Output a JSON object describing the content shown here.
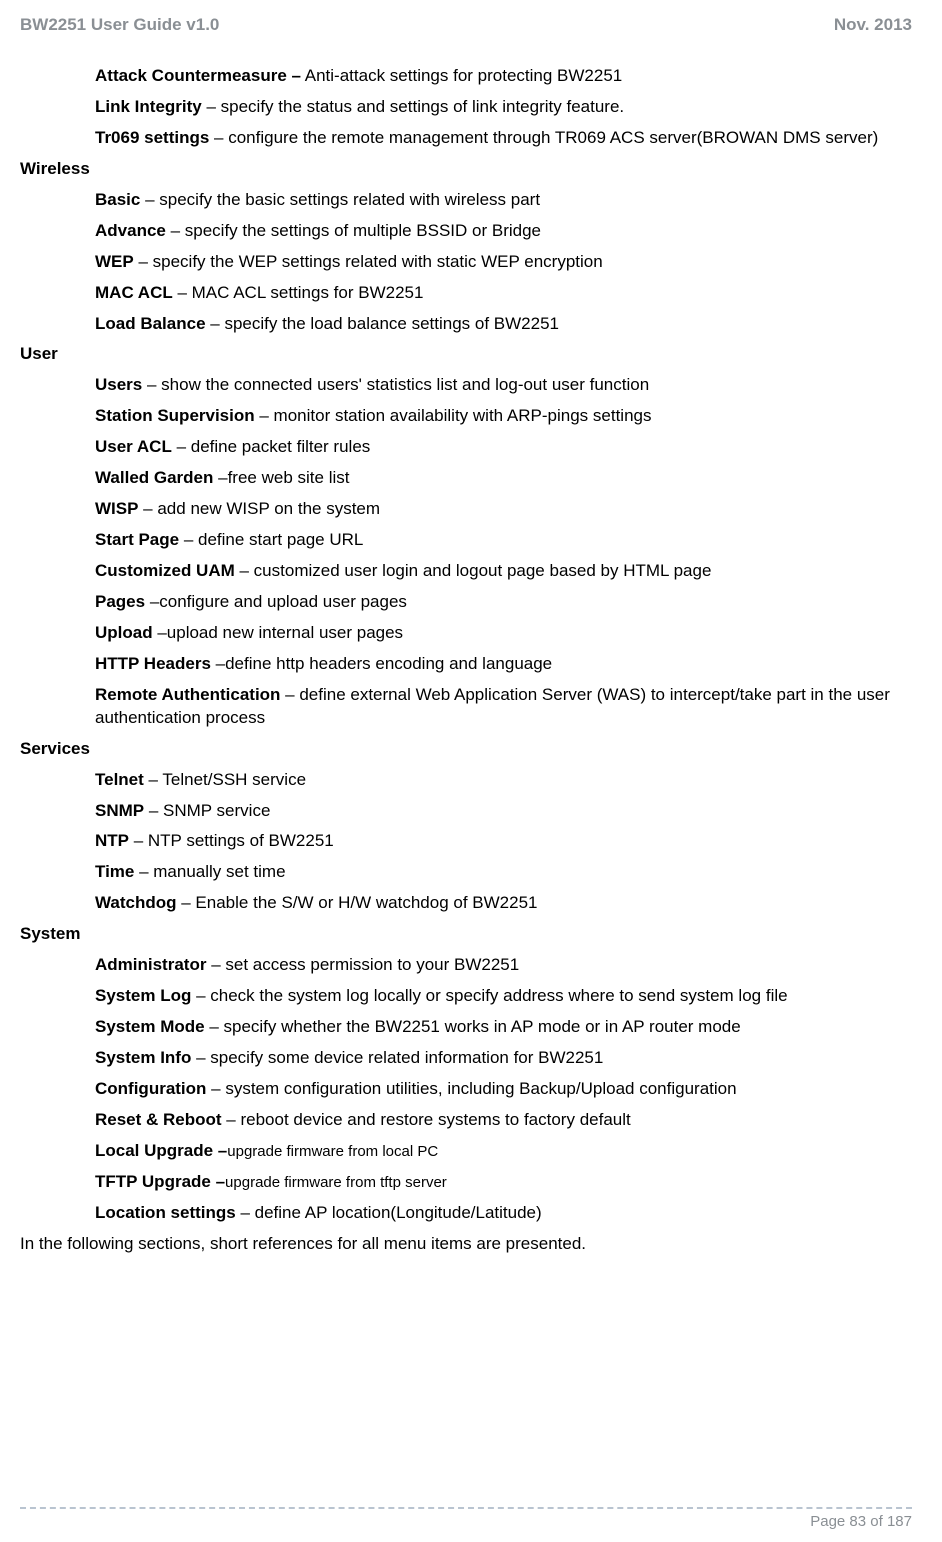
{
  "header": {
    "left": "BW2251 User Guide v1.0",
    "right": "Nov.  2013"
  },
  "pre_items": [
    {
      "term": "Attack Countermeasure –",
      "desc": " Anti-attack settings for protecting BW2251"
    },
    {
      "term": "Link Integrity",
      "desc": " – specify the status and settings of link integrity feature."
    },
    {
      "term": "Tr069 settings",
      "desc": " – configure the remote management through TR069 ACS server(BROWAN DMS server)"
    }
  ],
  "sections": [
    {
      "heading": "Wireless",
      "items": [
        {
          "term": "Basic",
          "desc": " – specify the basic settings related with wireless part"
        },
        {
          "term": "Advance",
          "desc": " – specify the settings of multiple BSSID or Bridge"
        },
        {
          "term": "WEP",
          "desc": " – specify the WEP settings related with static WEP encryption"
        },
        {
          "term": "MAC ACL",
          "desc": " – MAC ACL settings for BW2251"
        },
        {
          "term": "Load Balance",
          "desc": " – specify the load balance settings of BW2251"
        }
      ]
    },
    {
      "heading": "User",
      "items": [
        {
          "term": "Users",
          "desc": " – show the connected users' statistics list and log-out user function"
        },
        {
          "term": "Station Supervision",
          "desc": " – monitor station availability with ARP-pings settings"
        },
        {
          "term": "User ACL",
          "desc": " – define packet filter rules"
        },
        {
          "term": "Walled Garden",
          "desc": " –free web site list"
        },
        {
          "term": "WISP",
          "desc": " – add new WISP on the system"
        },
        {
          "term": "Start Page",
          "desc": " – define start page URL"
        },
        {
          "term": "Customized UAM",
          "desc": " – customized user login and logout page based by HTML page"
        },
        {
          "term": "Pages",
          "desc": " –configure and upload user pages"
        },
        {
          "term": "Upload",
          "desc": " –upload new internal user pages"
        },
        {
          "term": "HTTP Headers",
          "desc": " –define http headers encoding and language"
        },
        {
          "term": "Remote Authentication",
          "desc": " – define external Web Application Server (WAS) to intercept/take part in the user authentication process"
        }
      ]
    },
    {
      "heading": "Services",
      "items": [
        {
          "term": "Telnet",
          "desc": " – Telnet/SSH service"
        },
        {
          "term": "SNMP",
          "desc": " – SNMP service"
        },
        {
          "term": "NTP",
          "desc": " – NTP settings of BW2251"
        },
        {
          "term": "Time",
          "desc": " – manually set time"
        },
        {
          "term": "Watchdog",
          "desc": " – Enable the S/W or H/W watchdog of BW2251"
        }
      ]
    },
    {
      "heading": "System",
      "items": [
        {
          "term": "Administrator",
          "desc": " – set access permission to your BW2251"
        },
        {
          "term": "System Log",
          "desc": " – check the system log locally or specify address where to send system log file"
        },
        {
          "term": "System Mode",
          "desc": " – specify whether the BW2251 works in AP mode or in AP router mode"
        },
        {
          "term": "System Info",
          "desc": " – specify some device related information for BW2251"
        },
        {
          "term": "Configuration",
          "desc": " – system configuration utilities, including Backup/Upload configuration"
        },
        {
          "term": "Reset & Reboot",
          "desc": " – reboot device and restore systems to factory default"
        },
        {
          "term": "Local Upgrade –",
          "desc": "upgrade firmware from local PC",
          "descSmall": true
        },
        {
          "term": "TFTP Upgrade –",
          "desc": "upgrade firmware from tftp server",
          "descSmall": true
        },
        {
          "term": "Location settings",
          "desc": " – define AP location(Longitude/Latitude)"
        }
      ]
    }
  ],
  "outro": "In the following sections, short references for all menu items are presented.",
  "footer": {
    "page": "Page 83 of 187"
  }
}
